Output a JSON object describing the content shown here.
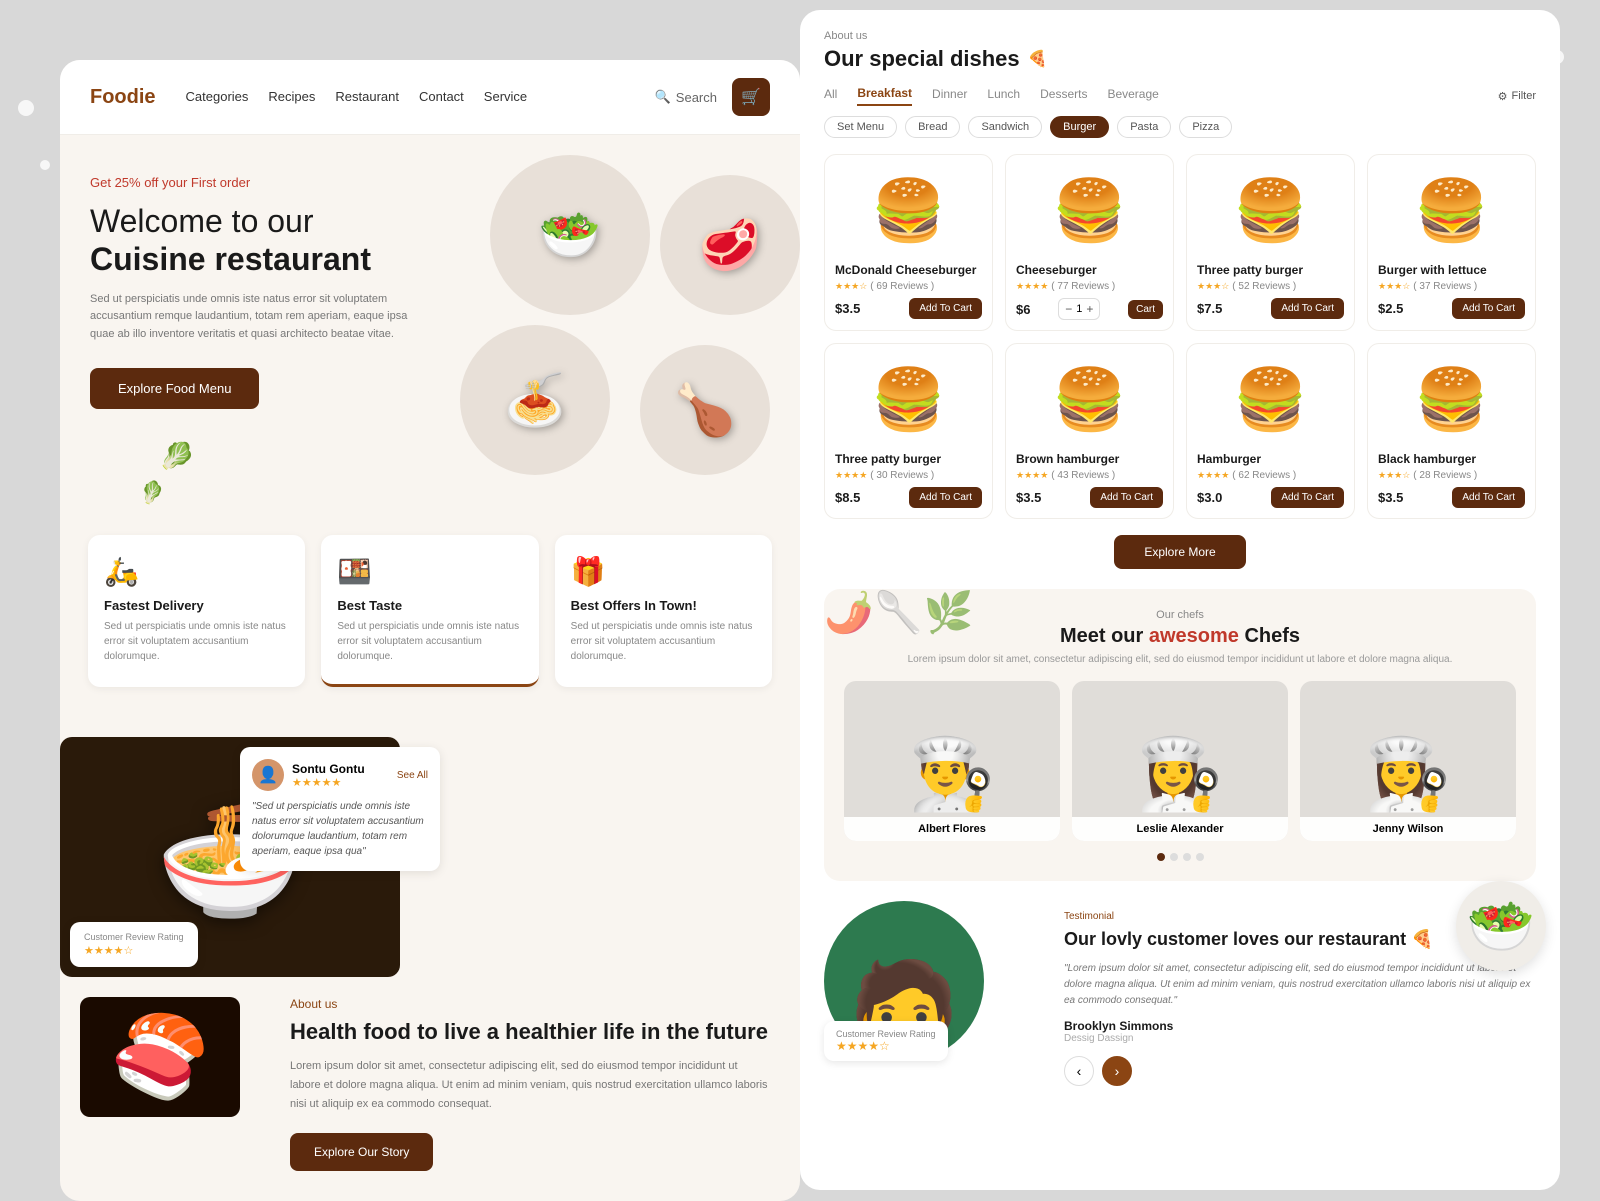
{
  "page": {
    "bg_color": "#d0cdc8"
  },
  "left": {
    "logo": "Foodie",
    "nav": {
      "links": [
        "Categories",
        "Recipes",
        "Restaurant",
        "Contact",
        "Service"
      ],
      "search_placeholder": "Search",
      "cart_icon": "🛒"
    },
    "hero": {
      "badge": "Get 25% off your First order",
      "title_line1": "Welcome to our",
      "title_line2": "Cuisine restaurant",
      "description": "Sed ut perspiciatis unde omnis iste natus error sit voluptatem accusantium remque laudantium, totam rem aperiam, eaque ipsa quae ab illo inventore veritatis et quasi architecto beatae vitae.",
      "cta_button": "Explore Food Menu"
    },
    "features": [
      {
        "icon": "🛵",
        "title": "Fastest Delivery",
        "desc": "Sed ut perspiciatis unde omnis iste natus error sit voluptatem accusantium dolorumque."
      },
      {
        "icon": "🍱",
        "title": "Best Taste",
        "desc": "Sed ut perspiciatis unde omnis iste natus error sit voluptatem accusantium dolorumque."
      },
      {
        "icon": "🎁",
        "title": "Best Offers In Town!",
        "desc": "Sed ut perspiciatis unde omnis iste natus error sit voluptatem accusantium dolorumque."
      }
    ],
    "review": {
      "name": "Sontu Gontu",
      "see_all": "See All",
      "text": "\"Sed ut perspiciatis unde omnis iste natus error sit voluptatem accusantium dolorumque laudantium, totam rem aperiam, eaque ipsa qua\"",
      "stars": "★★★★★",
      "rating_label": "Customer Review Rating",
      "rating_stars": "★★★★☆"
    },
    "about": {
      "label": "About us",
      "title": "Health food to live a healthier life in the future",
      "desc": "Lorem ipsum dolor sit amet, consectetur adipiscing elit, sed do eiusmod tempor incididunt ut labore et dolore magna aliqua. Ut enim ad minim veniam, quis nostrud exercitation ullamco laboris nisi ut aliquip ex ea commodo consequat.",
      "cta": "Explore Our Story"
    }
  },
  "right": {
    "about_us_label": "About us",
    "special_title": "Our special dishes",
    "filter_tabs": [
      "All",
      "Breakfast",
      "Dinner",
      "Lunch",
      "Desserts",
      "Beverage"
    ],
    "active_tab": "Breakfast",
    "filter_button": "Filter",
    "sub_filters": [
      "Set Menu",
      "Bread",
      "Sandwich",
      "Burger",
      "Pasta",
      "Pizza"
    ],
    "active_sub": "Burger",
    "food_items": [
      {
        "name": "McDonald Cheeseburger",
        "sub": "( 69 Reviews )",
        "stars": "★★★☆",
        "price": "$3.5",
        "action": "Add To Cart",
        "has_qty": false
      },
      {
        "name": "Cheeseburger",
        "sub": "( 77 Reviews )",
        "stars": "★★★★",
        "price": "$6",
        "action": "Cart",
        "has_qty": true,
        "qty": "1"
      },
      {
        "name": "Three patty burger",
        "sub": "( 52 Reviews )",
        "stars": "★★★☆",
        "price": "$7.5",
        "action": "Add To Cart",
        "has_qty": false
      },
      {
        "name": "Burger with lettuce",
        "sub": "( 37 Reviews )",
        "stars": "★★★☆",
        "price": "$2.5",
        "action": "Add To Cart",
        "has_qty": false
      },
      {
        "name": "Three patty burger",
        "sub": "( 30 Reviews )",
        "stars": "★★★★",
        "price": "$8.5",
        "action": "Add To Cart",
        "has_qty": false
      },
      {
        "name": "Brown hamburger",
        "sub": "( 43 Reviews )",
        "stars": "★★★★",
        "price": "$3.5",
        "action": "Add To Cart",
        "has_qty": false
      },
      {
        "name": "Hamburger",
        "sub": "( 62 Reviews )",
        "stars": "★★★★",
        "price": "$3.0",
        "action": "Add To Cart",
        "has_qty": false
      },
      {
        "name": "Black hamburger",
        "sub": "( 28 Reviews )",
        "stars": "★★★☆",
        "price": "$3.5",
        "action": "Add To Cart",
        "has_qty": false
      }
    ],
    "explore_more": "Explore More",
    "chefs": {
      "label": "Our chefs",
      "title": "Meet our awesome Chefs",
      "desc": "Lorem ipsum dolor sit amet, consectetur adipiscing elit, sed do eiusmod tempor incididunt ut labore et dolore magna aliqua.",
      "people": [
        {
          "name": "Albert Flores",
          "emoji": "👨‍🍳"
        },
        {
          "name": "Leslie Alexander",
          "emoji": "👩‍🍳"
        },
        {
          "name": "Jenny Wilson",
          "emoji": "👩‍🍳"
        }
      ]
    },
    "testimonial": {
      "label": "Testimonial",
      "title": "Our lovly customer loves our restaurant",
      "quote": "\"Lorem ipsum dolor sit amet, consectetur adipiscing elit, sed do eiusmod tempor incididunt ut labore et dolore magna aliqua. Ut enim ad minim veniam, quis nostrud exercitation ullamco laboris nisi ut aliquip ex ea commodo consequat.\"",
      "name": "Brooklyn Simmons",
      "role": "Dessig Dassign",
      "rating_label": "Customer Review Rating",
      "rating_stars": "★★★★☆"
    },
    "food_emojis": [
      "🍔",
      "🍔",
      "🍔",
      "🍔",
      "🍔",
      "🍔",
      "🍔",
      "🍔"
    ]
  }
}
